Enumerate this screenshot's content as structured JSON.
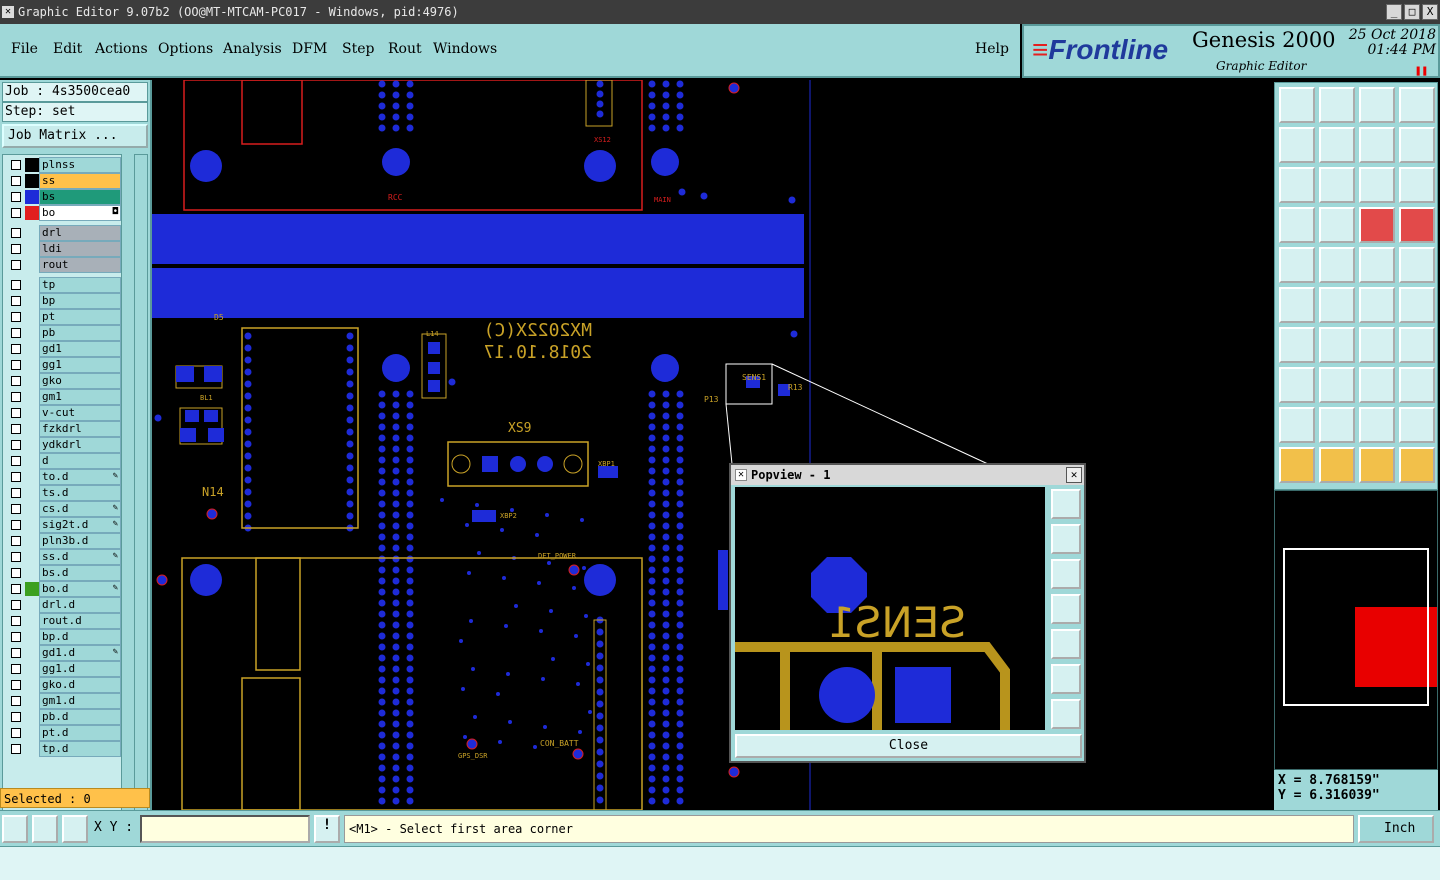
{
  "window": {
    "title": "Graphic Editor 9.07b2 (OO@MT-MTCAM-PC017 - Windows, pid:4976)",
    "buttons": [
      "_",
      "□",
      "X"
    ]
  },
  "menu": {
    "items": [
      "File",
      "Edit",
      "Actions",
      "Options",
      "Analysis",
      "DFM",
      "Step",
      "Rout",
      "Windows"
    ],
    "help": "Help"
  },
  "brand": {
    "logo": "Frontline",
    "product": "Genesis 2000",
    "subtitle": "Graphic Editor",
    "date": "25 Oct 2018",
    "time": "01:44 PM",
    "pause": "❚❚"
  },
  "job": {
    "job_label": "Job : 4s3500cea0",
    "step_label": "Step: set",
    "matrix_button": "Job Matrix ..."
  },
  "layers": [
    {
      "name": "plnss",
      "color": "#000000",
      "style": ""
    },
    {
      "name": "ss",
      "color": "#000000",
      "style": "sel"
    },
    {
      "name": "bs",
      "color": "#1e2bd8",
      "style": "bs"
    },
    {
      "name": "bo",
      "color": "#e21f1f",
      "style": "bo",
      "mark": "◘"
    },
    {
      "name": "drl",
      "color": "",
      "style": "drl"
    },
    {
      "name": "ldi",
      "color": "",
      "style": "drl"
    },
    {
      "name": "rout",
      "color": "",
      "style": "drl"
    },
    {
      "name": "tp",
      "color": "",
      "style": ""
    },
    {
      "name": "bp",
      "color": "",
      "style": ""
    },
    {
      "name": "pt",
      "color": "",
      "style": ""
    },
    {
      "name": "pb",
      "color": "",
      "style": ""
    },
    {
      "name": "gd1",
      "color": "",
      "style": ""
    },
    {
      "name": "gg1",
      "color": "",
      "style": ""
    },
    {
      "name": "gko",
      "color": "",
      "style": ""
    },
    {
      "name": "gm1",
      "color": "",
      "style": ""
    },
    {
      "name": "v-cut",
      "color": "",
      "style": ""
    },
    {
      "name": "fzkdrl",
      "color": "",
      "style": ""
    },
    {
      "name": "ydkdrl",
      "color": "",
      "style": ""
    },
    {
      "name": "d",
      "color": "",
      "style": ""
    },
    {
      "name": "to.d",
      "color": "",
      "style": "",
      "mark": "✎"
    },
    {
      "name": "ts.d",
      "color": "",
      "style": ""
    },
    {
      "name": "cs.d",
      "color": "",
      "style": "",
      "mark": "✎"
    },
    {
      "name": "sig2t.d",
      "color": "",
      "style": "",
      "mark": "✎"
    },
    {
      "name": "pln3b.d",
      "color": "",
      "style": ""
    },
    {
      "name": "ss.d",
      "color": "",
      "style": "",
      "mark": "✎"
    },
    {
      "name": "bs.d",
      "color": "",
      "style": ""
    },
    {
      "name": "bo.d",
      "color": "#3ca020",
      "style": "",
      "mark": "✎"
    },
    {
      "name": "drl.d",
      "color": "",
      "style": ""
    },
    {
      "name": "rout.d",
      "color": "",
      "style": ""
    },
    {
      "name": "bp.d",
      "color": "",
      "style": ""
    },
    {
      "name": "gd1.d",
      "color": "",
      "style": "",
      "mark": "✎"
    },
    {
      "name": "gg1.d",
      "color": "",
      "style": ""
    },
    {
      "name": "gko.d",
      "color": "",
      "style": ""
    },
    {
      "name": "gm1.d",
      "color": "",
      "style": ""
    },
    {
      "name": "pb.d",
      "color": "",
      "style": ""
    },
    {
      "name": "pt.d",
      "color": "",
      "style": ""
    },
    {
      "name": "tp.d",
      "color": "",
      "style": ""
    }
  ],
  "selected": "Selected : 0",
  "board_text": {
    "mark1": "MX2022X(C)",
    "mark2": "2018.10.17",
    "xs9": "XS9",
    "n14": "N14",
    "sens1": "SENS1",
    "p13": "P13",
    "r13": "R13",
    "rcc": "RCC",
    "xs12": "XS12",
    "main": "MAIN",
    "xbp2": "XBP2",
    "xbp1": "XBP1",
    "det_power": "DET_POWER",
    "con_batt": "CON_BATT",
    "gps_ds": "GPS_DSR",
    "d5": "D5",
    "bl1": "BL1",
    "l14": "L14"
  },
  "popview": {
    "title": "Popview - 1",
    "label": "SENS1",
    "close_label": "Close"
  },
  "coords": {
    "x": "X =  8.768159\"",
    "y": "Y =  6.316039\""
  },
  "status": {
    "xy_label": "X Y :",
    "xy_value": "",
    "message": "<M1> - Select first area corner",
    "unit": "Inch"
  }
}
